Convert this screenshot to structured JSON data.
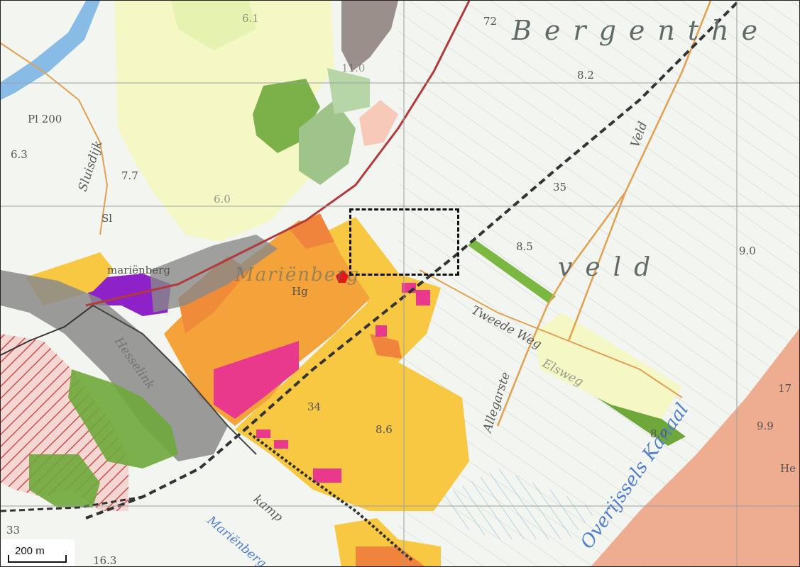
{
  "labels": {
    "bergenthe": "Bergenthe",
    "veld": "veld",
    "marienberg_town": "Mariënberg",
    "hg": "Hg",
    "marienberg_small": "mariënberg",
    "sluisdijk": "Sluisdijk",
    "pl200": "Pl 200",
    "sl": "Sl",
    "hesselink": "Hesselink",
    "tweede_weg": "Tweede Weg",
    "veld_road": "Veld",
    "allegarste": "Allegarste",
    "elsweg": "Elsweg",
    "overijssels_kanaal": "Overijssels Kanaal",
    "kamp": "kamp",
    "marienberg_water": "Mariënberg",
    "he": "He"
  },
  "spot_heights": {
    "h1": "8.2",
    "h2": "35",
    "h3": "8.5",
    "h4": "9.0",
    "h5": "6.3",
    "h6": "7.7",
    "h7": "6.0",
    "h8": "6.1",
    "h9": "11.0",
    "h10": "34",
    "h11": "8.6",
    "h12": "8.0",
    "h13": "9.9",
    "h14": "17",
    "h15": "33",
    "h16": "16.3",
    "h17": "72"
  },
  "scale_bar": {
    "label": "200 m"
  },
  "legend_colors": {
    "residential": "#f4a33a",
    "industrial": "#f8c842",
    "commercial": "#e8398c",
    "agricultural": "#f5f7c4",
    "nature": "#6ea83b",
    "water": "#5aa4e3",
    "railway": "#333333",
    "infrastructure": "#8a8a8a",
    "canal_zone": "#eda585"
  }
}
